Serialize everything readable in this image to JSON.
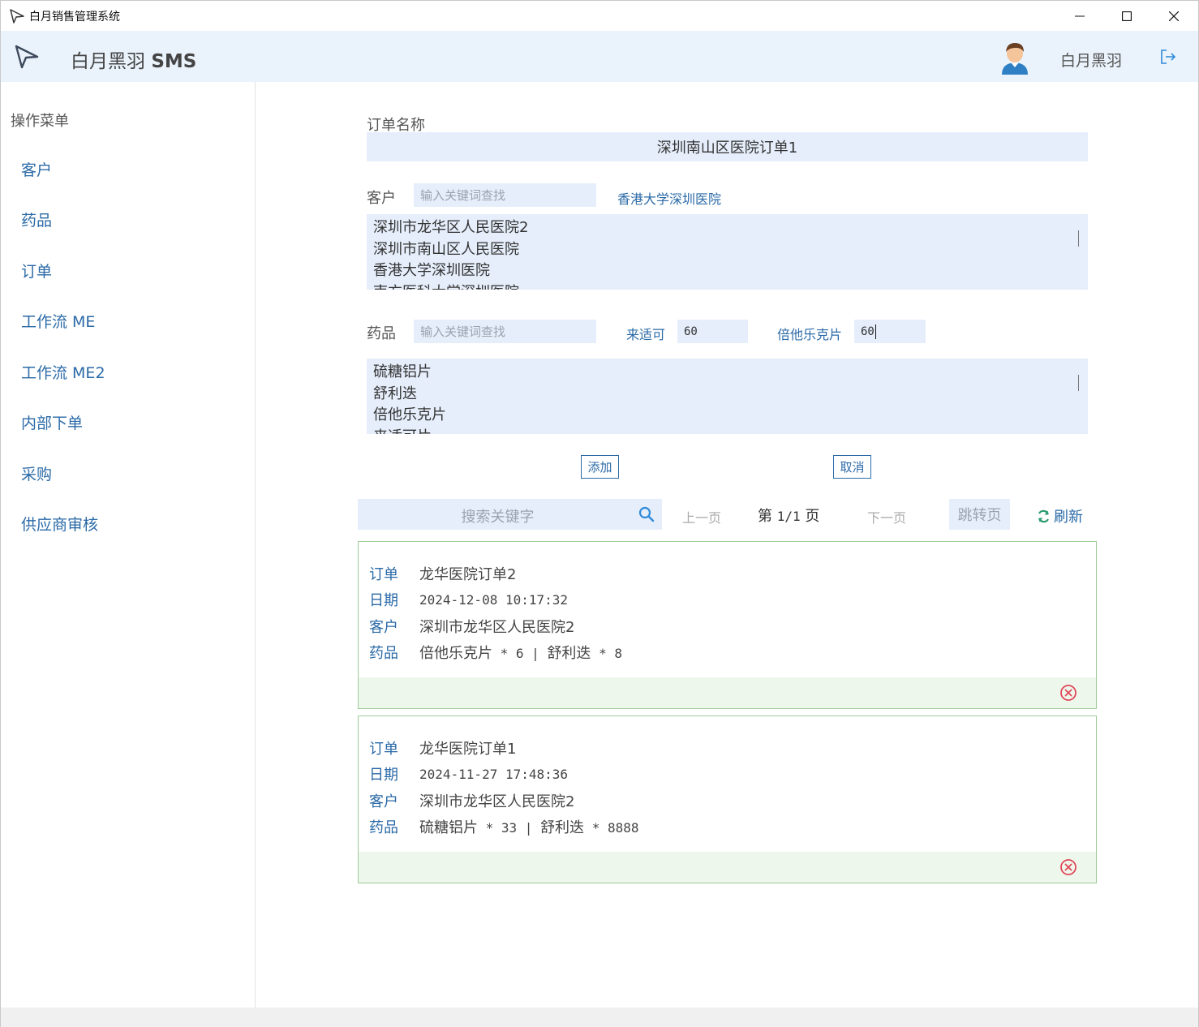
{
  "window": {
    "title": "白月销售管理系统"
  },
  "header": {
    "brand_name": "白月黑羽 ",
    "brand_suffix": "SMS",
    "username": "白月黑羽"
  },
  "sidebar": {
    "title": "操作菜单",
    "items": [
      {
        "label": "客户"
      },
      {
        "label": "药品"
      },
      {
        "label": "订单"
      },
      {
        "label": "工作流 ME"
      },
      {
        "label": "工作流 ME2"
      },
      {
        "label": "内部下单"
      },
      {
        "label": "采购"
      },
      {
        "label": "供应商审核"
      }
    ]
  },
  "form": {
    "order_name_label": "订单名称",
    "order_name_value": "深圳南山区医院订单1",
    "customer_label": "客户",
    "customer_search_placeholder": "输入关键词查找",
    "selected_customer": "香港大学深圳医院",
    "customer_options": [
      "深圳市龙华区人民医院2",
      "深圳市南山区人民医院",
      "香港大学深圳医院",
      "南方医科大学深圳医院"
    ],
    "drug_label": "药品",
    "drug_search_placeholder": "输入关键词查找",
    "selected_drugs": [
      {
        "name": "来适可",
        "qty": "60"
      },
      {
        "name": "倍他乐克片",
        "qty": "60"
      }
    ],
    "drug_options": [
      "硫糖铝片",
      "舒利迭",
      "倍他乐克片",
      "来适可片"
    ],
    "add_button": "添加",
    "cancel_button": "取消"
  },
  "toolbar": {
    "search_placeholder": "搜索关键字",
    "prev_page": "上一页",
    "page_prefix": "第 ",
    "page_value": "1/1",
    "page_suffix": " 页",
    "next_page": "下一页",
    "jump_page": "跳转页",
    "refresh": "刷新"
  },
  "orders": [
    {
      "k_order": "订单",
      "order": "龙华医院订单2",
      "k_date": "日期",
      "date": "2024-12-08 10:17:32",
      "k_customer": "客户",
      "customer": "深圳市龙华区人民医院2",
      "k_drugs": "药品",
      "drugs_part1": "倍他乐克片",
      "drugs_part2": " * 6 | ",
      "drugs_part3": "舒利迭",
      "drugs_part4": " * 8"
    },
    {
      "k_order": "订单",
      "order": "龙华医院订单1",
      "k_date": "日期",
      "date": "2024-11-27 17:48:36",
      "k_customer": "客户",
      "customer": "深圳市龙华区人民医院2",
      "k_drugs": "药品",
      "drugs_part1": "硫糖铝片",
      "drugs_part2": " * 33 | ",
      "drugs_part3": "舒利迭",
      "drugs_part4": " * 8888"
    }
  ],
  "colors": {
    "accent": "#2b6aa7",
    "field_bg": "#e6eefb",
    "header_bg": "#eaf3fc",
    "card_border": "#9fcd98",
    "card_footer": "#eef7ec",
    "delete": "#e0485a"
  },
  "icons": {
    "app": "paper-plane-icon",
    "avatar": "user-avatar-icon",
    "logout": "logout-icon",
    "search": "search-icon",
    "refresh": "refresh-icon",
    "delete": "circle-x-icon"
  }
}
